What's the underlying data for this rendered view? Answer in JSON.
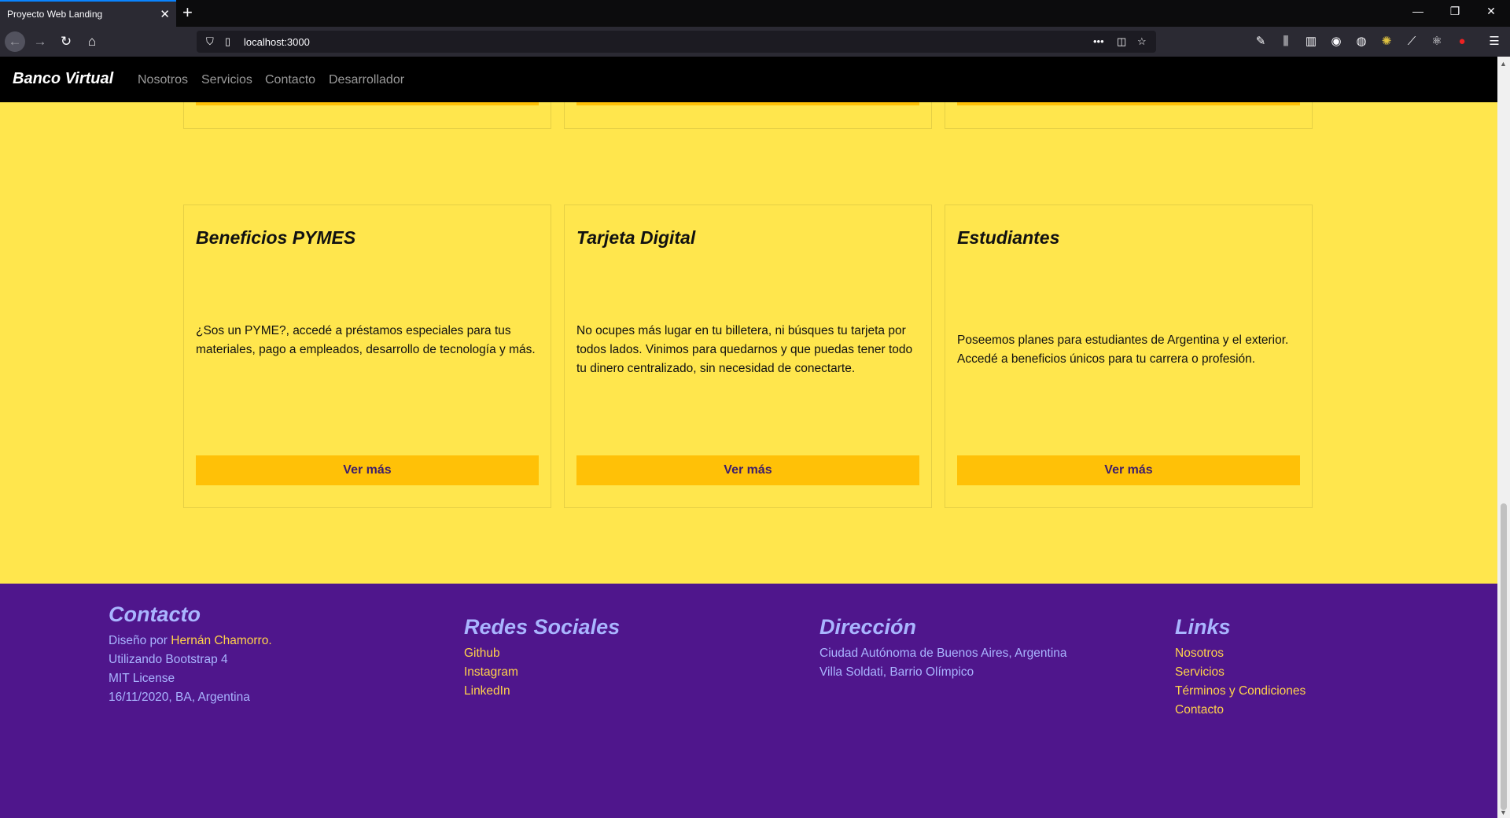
{
  "browser": {
    "tab_title": "Proyecto Web Landing",
    "url": "localhost:3000"
  },
  "site": {
    "brand": "Banco Virtual",
    "nav": [
      "Nosotros",
      "Servicios",
      "Contacto",
      "Desarrollador"
    ]
  },
  "cards": [
    {
      "title": "Beneficios PYMES",
      "text": "¿Sos un PYME?, accedé a préstamos especiales para tus materiales, pago a empleados, desarrollo de tecnología y más.",
      "button": "Ver más"
    },
    {
      "title": "Tarjeta Digital",
      "text": "No ocupes más lugar en tu billetera, ni búsques tu tarjeta por todos lados. Vinimos para quedarnos y que puedas tener todo tu dinero centralizado, sin necesidad de conectarte.",
      "button": "Ver más"
    },
    {
      "title": "Estudiantes",
      "text": "Poseemos planes para estudiantes de Argentina y el exterior. Accedé a beneficios únicos para tu carrera o profesión.",
      "button": "Ver más"
    }
  ],
  "footer": {
    "contacto": {
      "heading": "Contacto",
      "design_prefix": "Diseño por ",
      "author": "Hernán Chamorro.",
      "lines": [
        "Utilizando Bootstrap 4",
        "MIT License",
        "16/11/2020, BA, Argentina"
      ]
    },
    "redes": {
      "heading": "Redes Sociales",
      "links": [
        "Github",
        "Instagram",
        "LinkedIn"
      ]
    },
    "direccion": {
      "heading": "Dirección",
      "lines": [
        "Ciudad Autónoma de Buenos Aires, Argentina",
        "Villa Soldati, Barrio Olímpico"
      ]
    },
    "links": {
      "heading": "Links",
      "links": [
        "Nosotros",
        "Servicios",
        "Términos y Condiciones",
        "Contacto"
      ]
    }
  }
}
